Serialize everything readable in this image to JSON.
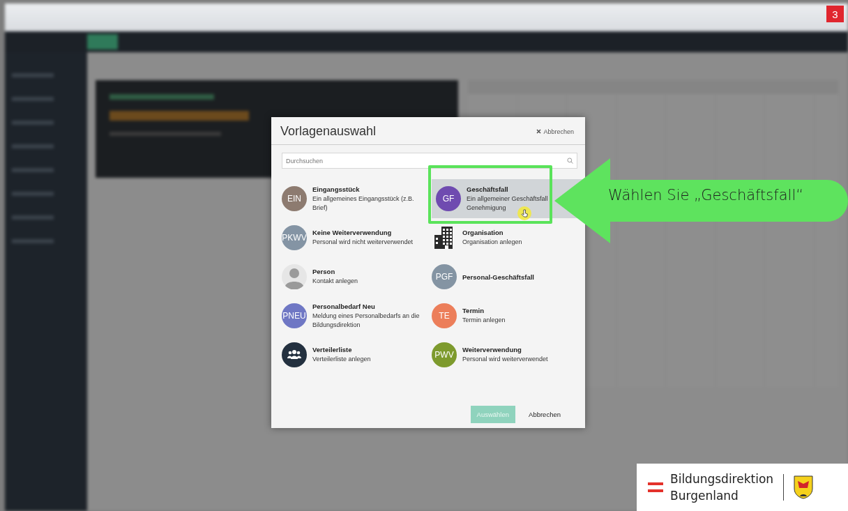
{
  "badge": "3",
  "dialog": {
    "title": "Vorlagenauswahl",
    "close_label": "Abbrechen",
    "search": {
      "placeholder": "Durchsuchen"
    },
    "templates": [
      {
        "title": "Eingangsstück",
        "description": "Ein allgemeines Eingangsstück (z.B. Brief)",
        "avatar": {
          "kind": "initials",
          "text": "EIN",
          "color": "#8d7b70"
        },
        "selected": false
      },
      {
        "title": "Geschäftsfall",
        "description": "Ein allgemeiner Geschäftsfall Genehmigung",
        "avatar": {
          "kind": "initials",
          "text": "GF",
          "color": "#6f4bb0"
        },
        "selected": true
      },
      {
        "title": "Keine Weiterverwendung",
        "description": "Personal wird nicht weiterverwendet",
        "avatar": {
          "kind": "initials",
          "text": "PKWV",
          "color": "#8494a4"
        },
        "selected": false
      },
      {
        "title": "Organisation",
        "description": "Organisation anlegen",
        "avatar": {
          "kind": "building",
          "color": "#2a2a2a"
        },
        "selected": false
      },
      {
        "title": "Person",
        "description": "Kontakt anlegen",
        "avatar": {
          "kind": "person",
          "color": "#e6e6e6"
        },
        "selected": false
      },
      {
        "title": "Personal-Geschäftsfall",
        "avatar": {
          "kind": "initials",
          "text": "PGF",
          "color": "#8494a3"
        },
        "selected": false
      },
      {
        "title": "Personalbedarf Neu",
        "description": "Meldung eines Personalbedarfs an die Bildungsdirektion",
        "avatar": {
          "kind": "initials",
          "text": "PNEU",
          "color": "#6f77c4"
        },
        "selected": false
      },
      {
        "title": "Termin",
        "description": "Termin anlegen",
        "avatar": {
          "kind": "initials",
          "text": "TE",
          "color": "#ec7e5a"
        },
        "selected": false
      },
      {
        "title": "Verteilerliste",
        "description": "Verteilerliste anlegen",
        "avatar": {
          "kind": "group",
          "color": "#23303f"
        },
        "selected": false
      },
      {
        "title": "Weiterverwendung",
        "description": "Personal wird weiterverwendet",
        "avatar": {
          "kind": "initials",
          "text": "PWV",
          "color": "#7d9a2d"
        },
        "selected": false
      }
    ],
    "buttons": [
      {
        "label": "Auswählen",
        "kind": "primary",
        "disabled": true
      },
      {
        "label": "Abbrechen",
        "kind": "link",
        "disabled": false
      }
    ]
  },
  "callout": {
    "text": "Wählen Sie „Geschäftsfall“"
  },
  "logo": {
    "line1": "Bildungsdirektion",
    "line2": "Burgenland"
  }
}
